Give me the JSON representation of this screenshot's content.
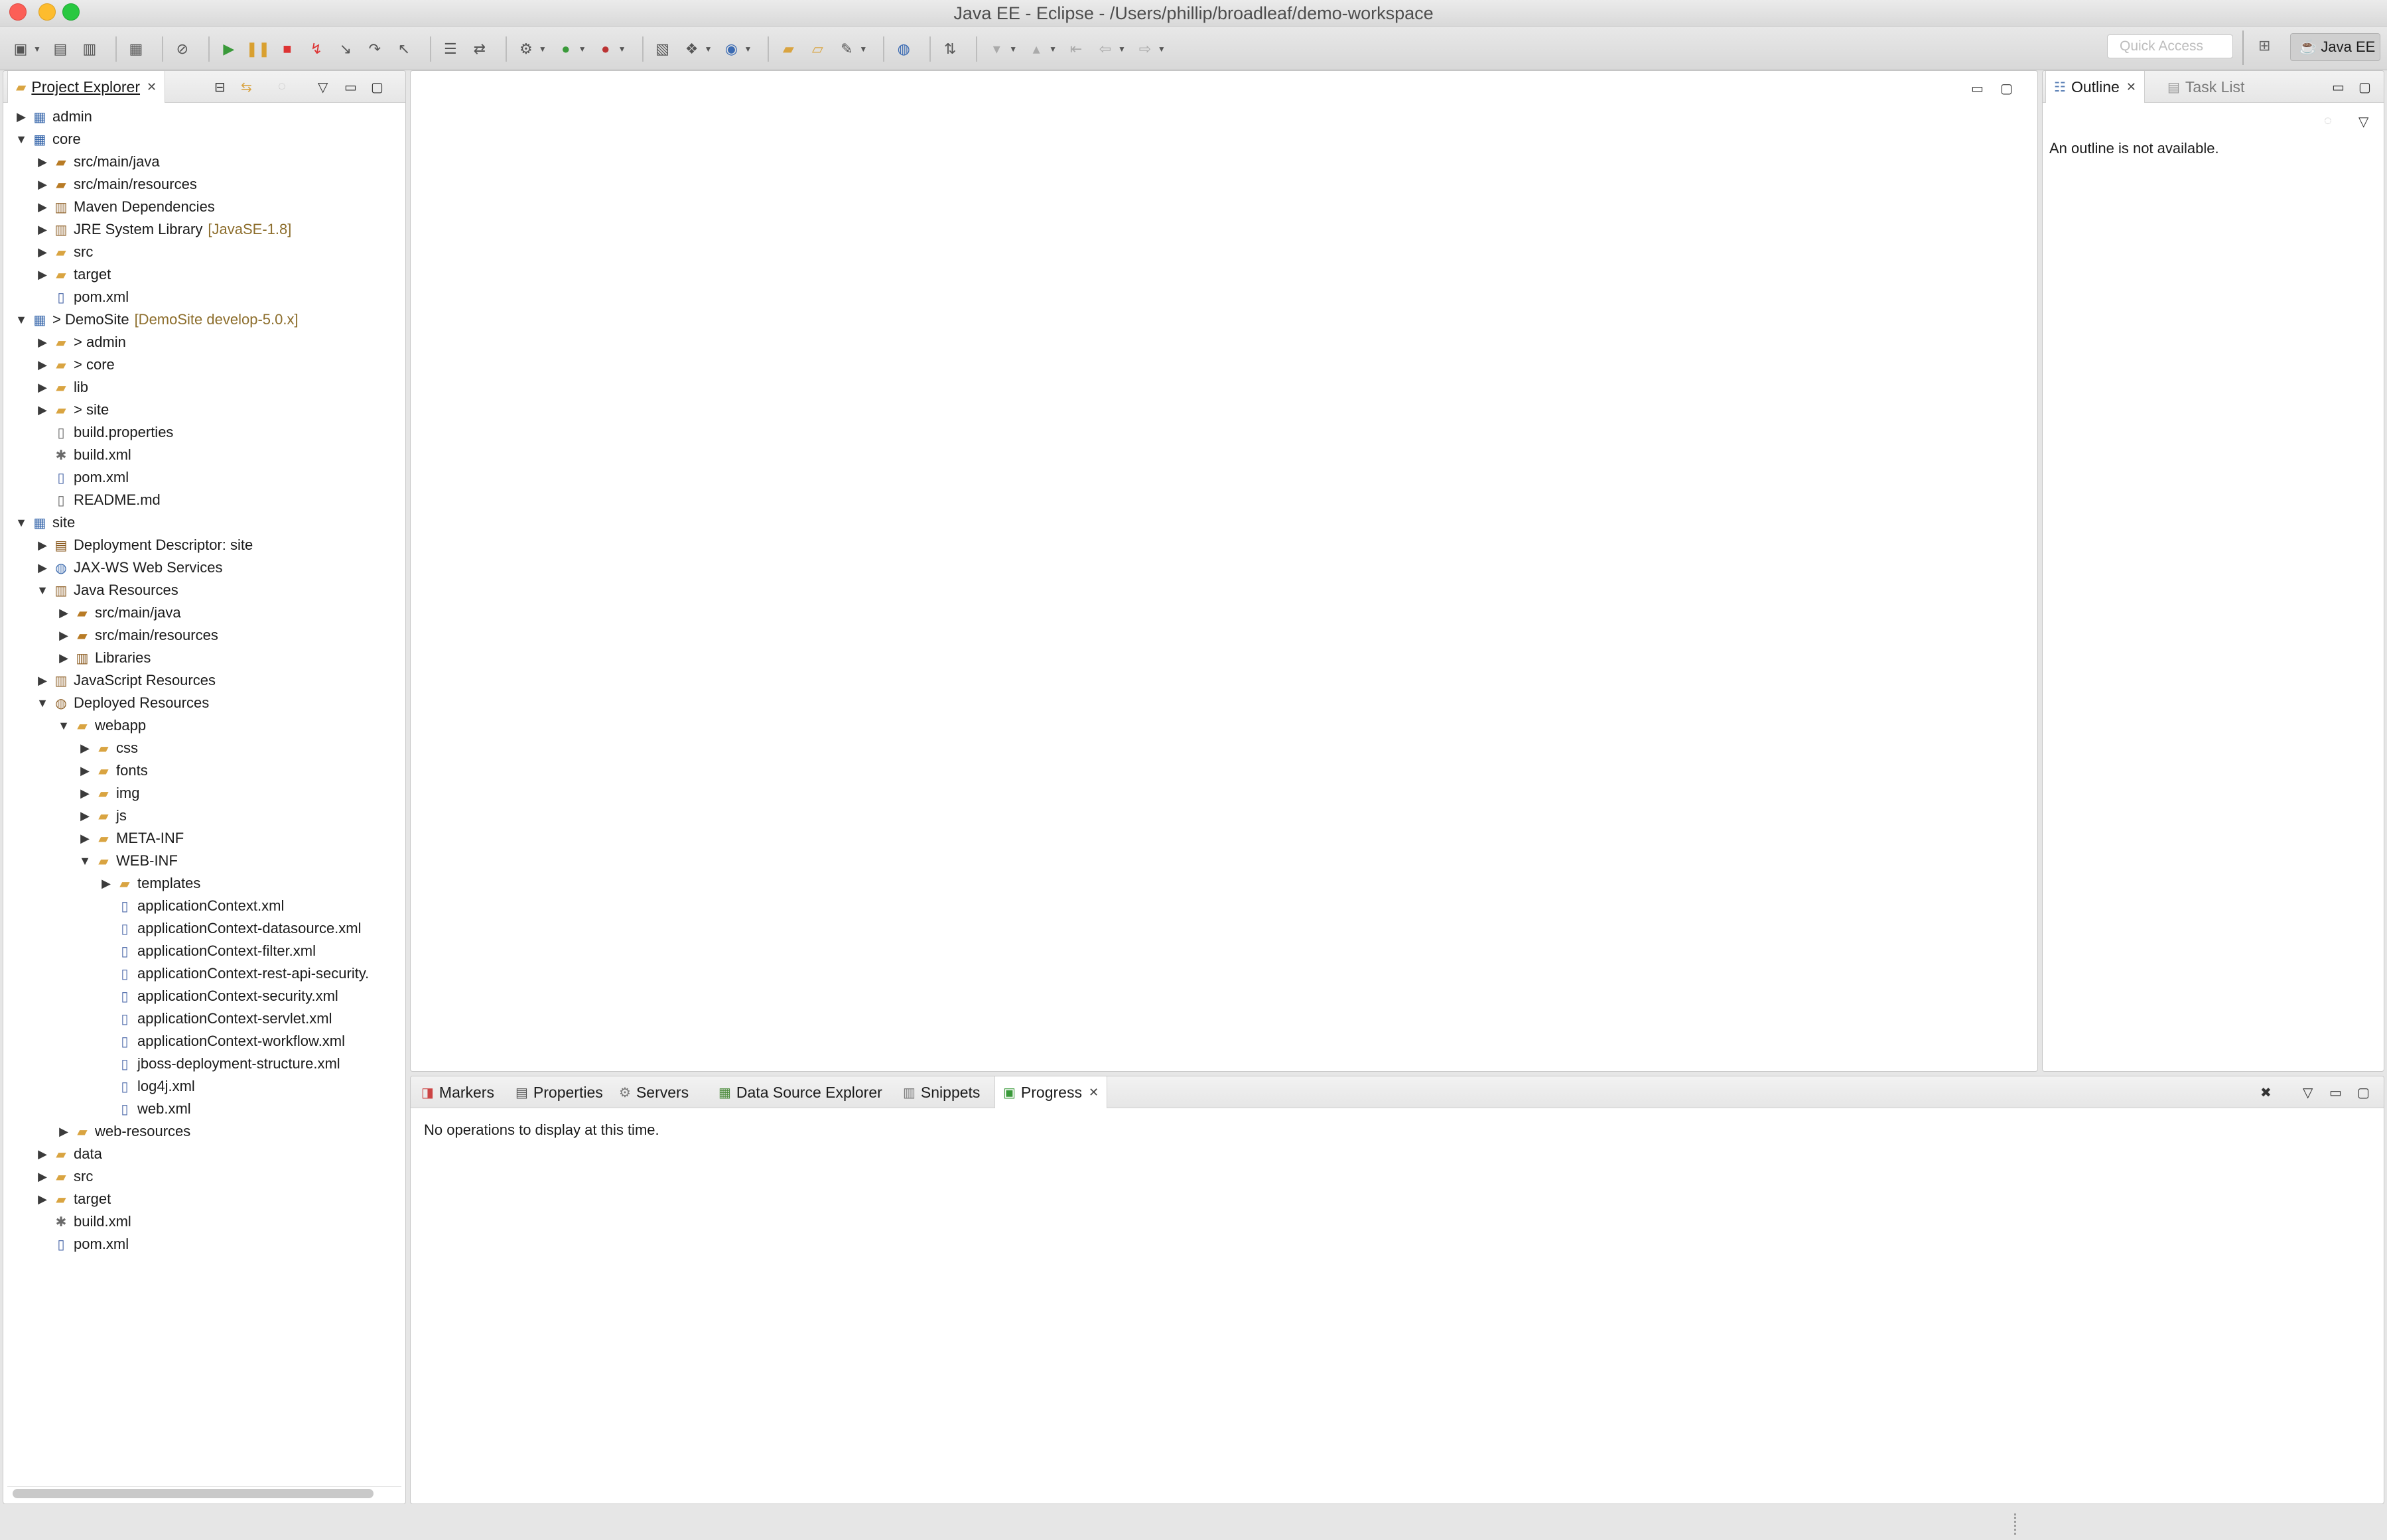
{
  "window": {
    "title": "Java EE - Eclipse - /Users/phillip/broadleaf/demo-workspace"
  },
  "toolbar": {
    "quick_access_placeholder": "Quick Access",
    "perspective_label": "Java EE"
  },
  "project_explorer": {
    "tab_label": "Project Explorer",
    "tree": [
      {
        "depth": 0,
        "twisty": "collapsed",
        "icon": "project-icon",
        "label": "admin",
        "deco": ""
      },
      {
        "depth": 0,
        "twisty": "expanded",
        "icon": "project-icon",
        "label": "core",
        "deco": ""
      },
      {
        "depth": 1,
        "twisty": "collapsed",
        "icon": "package-folder-icon",
        "label": "src/main/java",
        "deco": ""
      },
      {
        "depth": 1,
        "twisty": "collapsed",
        "icon": "package-folder-icon",
        "label": "src/main/resources",
        "deco": ""
      },
      {
        "depth": 1,
        "twisty": "collapsed",
        "icon": "library-icon",
        "label": "Maven Dependencies",
        "deco": ""
      },
      {
        "depth": 1,
        "twisty": "collapsed",
        "icon": "library-icon",
        "label": "JRE System Library",
        "deco": "[JavaSE-1.8]"
      },
      {
        "depth": 1,
        "twisty": "collapsed",
        "icon": "folder-icon",
        "label": "src",
        "deco": ""
      },
      {
        "depth": 1,
        "twisty": "collapsed",
        "icon": "folder-icon",
        "label": "target",
        "deco": ""
      },
      {
        "depth": 1,
        "twisty": "none",
        "icon": "xml-file-icon",
        "label": "pom.xml",
        "deco": ""
      },
      {
        "depth": 0,
        "twisty": "expanded",
        "icon": "project-icon",
        "label": "> DemoSite",
        "deco": "[DemoSite develop-5.0.x]"
      },
      {
        "depth": 1,
        "twisty": "collapsed",
        "icon": "folder-icon",
        "label": "> admin",
        "deco": ""
      },
      {
        "depth": 1,
        "twisty": "collapsed",
        "icon": "folder-icon",
        "label": "> core",
        "deco": ""
      },
      {
        "depth": 1,
        "twisty": "collapsed",
        "icon": "folder-icon",
        "label": "lib",
        "deco": ""
      },
      {
        "depth": 1,
        "twisty": "collapsed",
        "icon": "folder-icon",
        "label": "> site",
        "deco": ""
      },
      {
        "depth": 1,
        "twisty": "none",
        "icon": "properties-file-icon",
        "label": "build.properties",
        "deco": ""
      },
      {
        "depth": 1,
        "twisty": "none",
        "icon": "ant-file-icon",
        "label": "build.xml",
        "deco": ""
      },
      {
        "depth": 1,
        "twisty": "none",
        "icon": "xml-file-icon",
        "label": "pom.xml",
        "deco": ""
      },
      {
        "depth": 1,
        "twisty": "none",
        "icon": "text-file-icon",
        "label": "README.md",
        "deco": ""
      },
      {
        "depth": 0,
        "twisty": "expanded",
        "icon": "project-icon",
        "label": "site",
        "deco": ""
      },
      {
        "depth": 1,
        "twisty": "collapsed",
        "icon": "descriptor-icon",
        "label": "Deployment Descriptor: site",
        "deco": ""
      },
      {
        "depth": 1,
        "twisty": "collapsed",
        "icon": "web-services-icon",
        "label": "JAX-WS Web Services",
        "deco": ""
      },
      {
        "depth": 1,
        "twisty": "expanded",
        "icon": "library-icon",
        "label": "Java Resources",
        "deco": ""
      },
      {
        "depth": 2,
        "twisty": "collapsed",
        "icon": "package-folder-icon",
        "label": "src/main/java",
        "deco": ""
      },
      {
        "depth": 2,
        "twisty": "collapsed",
        "icon": "package-folder-icon",
        "label": "src/main/resources",
        "deco": ""
      },
      {
        "depth": 2,
        "twisty": "collapsed",
        "icon": "library-icon",
        "label": "Libraries",
        "deco": ""
      },
      {
        "depth": 1,
        "twisty": "collapsed",
        "icon": "library-icon",
        "label": "JavaScript Resources",
        "deco": ""
      },
      {
        "depth": 1,
        "twisty": "expanded",
        "icon": "deployed-icon",
        "label": "Deployed Resources",
        "deco": ""
      },
      {
        "depth": 2,
        "twisty": "expanded",
        "icon": "folder-icon",
        "label": "webapp",
        "deco": ""
      },
      {
        "depth": 3,
        "twisty": "collapsed",
        "icon": "folder-icon",
        "label": "css",
        "deco": ""
      },
      {
        "depth": 3,
        "twisty": "collapsed",
        "icon": "folder-icon",
        "label": "fonts",
        "deco": ""
      },
      {
        "depth": 3,
        "twisty": "collapsed",
        "icon": "folder-icon",
        "label": "img",
        "deco": ""
      },
      {
        "depth": 3,
        "twisty": "collapsed",
        "icon": "folder-icon",
        "label": "js",
        "deco": ""
      },
      {
        "depth": 3,
        "twisty": "collapsed",
        "icon": "folder-icon",
        "label": "META-INF",
        "deco": ""
      },
      {
        "depth": 3,
        "twisty": "expanded",
        "icon": "folder-icon",
        "label": "WEB-INF",
        "deco": ""
      },
      {
        "depth": 4,
        "twisty": "collapsed",
        "icon": "folder-icon",
        "label": "templates",
        "deco": ""
      },
      {
        "depth": 4,
        "twisty": "none",
        "icon": "xml-file-icon",
        "label": "applicationContext.xml",
        "deco": ""
      },
      {
        "depth": 4,
        "twisty": "none",
        "icon": "xml-file-icon",
        "label": "applicationContext-datasource.xml",
        "deco": ""
      },
      {
        "depth": 4,
        "twisty": "none",
        "icon": "xml-file-icon",
        "label": "applicationContext-filter.xml",
        "deco": ""
      },
      {
        "depth": 4,
        "twisty": "none",
        "icon": "xml-file-icon",
        "label": "applicationContext-rest-api-security.",
        "deco": ""
      },
      {
        "depth": 4,
        "twisty": "none",
        "icon": "xml-file-icon",
        "label": "applicationContext-security.xml",
        "deco": ""
      },
      {
        "depth": 4,
        "twisty": "none",
        "icon": "xml-file-icon",
        "label": "applicationContext-servlet.xml",
        "deco": ""
      },
      {
        "depth": 4,
        "twisty": "none",
        "icon": "xml-file-icon",
        "label": "applicationContext-workflow.xml",
        "deco": ""
      },
      {
        "depth": 4,
        "twisty": "none",
        "icon": "xml-file-icon",
        "label": "jboss-deployment-structure.xml",
        "deco": ""
      },
      {
        "depth": 4,
        "twisty": "none",
        "icon": "xml-file-icon",
        "label": "log4j.xml",
        "deco": ""
      },
      {
        "depth": 4,
        "twisty": "none",
        "icon": "xml-file-icon",
        "label": "web.xml",
        "deco": ""
      },
      {
        "depth": 2,
        "twisty": "collapsed",
        "icon": "folder-icon",
        "label": "web-resources",
        "deco": ""
      },
      {
        "depth": 1,
        "twisty": "collapsed",
        "icon": "folder-icon",
        "label": "data",
        "deco": ""
      },
      {
        "depth": 1,
        "twisty": "collapsed",
        "icon": "folder-icon",
        "label": "src",
        "deco": ""
      },
      {
        "depth": 1,
        "twisty": "collapsed",
        "icon": "folder-icon",
        "label": "target",
        "deco": ""
      },
      {
        "depth": 1,
        "twisty": "none",
        "icon": "ant-file-icon",
        "label": "build.xml",
        "deco": ""
      },
      {
        "depth": 1,
        "twisty": "none",
        "icon": "xml-file-icon",
        "label": "pom.xml",
        "deco": ""
      }
    ]
  },
  "outline": {
    "tabs": [
      {
        "label": "Outline",
        "active": true
      },
      {
        "label": "Task List",
        "active": false
      }
    ],
    "message": "An outline is not available."
  },
  "bottom_panel": {
    "tabs": [
      {
        "label": "Markers",
        "icon": "markers-icon",
        "active": false
      },
      {
        "label": "Properties",
        "icon": "properties-icon",
        "active": false
      },
      {
        "label": "Servers",
        "icon": "servers-icon",
        "active": false
      },
      {
        "label": "Data Source Explorer",
        "icon": "data-source-icon",
        "active": false
      },
      {
        "label": "Snippets",
        "icon": "snippets-icon",
        "active": false
      },
      {
        "label": "Progress",
        "icon": "progress-icon",
        "active": true
      }
    ],
    "message": "No operations to display at this time."
  }
}
